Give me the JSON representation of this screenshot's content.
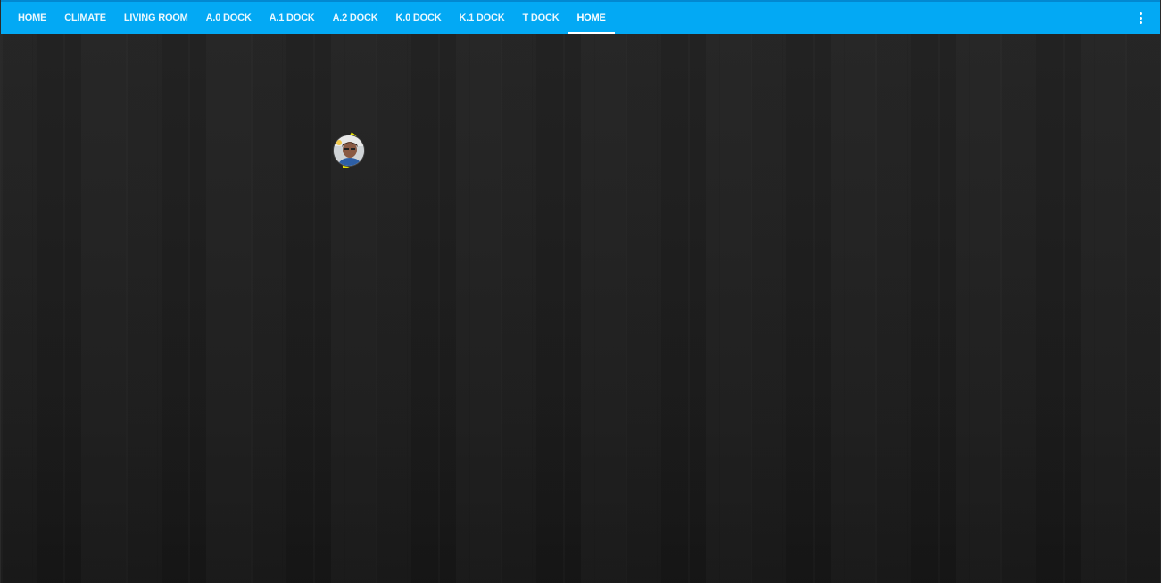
{
  "nav": {
    "tabs": [
      {
        "label": "HOME"
      },
      {
        "label": "CLIMATE"
      },
      {
        "label": "LIVING ROOM"
      },
      {
        "label": "A.0 DOCK"
      },
      {
        "label": "A.1 DOCK"
      },
      {
        "label": "A.2 DOCK"
      },
      {
        "label": "K.0 DOCK"
      },
      {
        "label": "K.1 DOCK"
      },
      {
        "label": "T DOCK"
      },
      {
        "label": "HOME"
      }
    ],
    "active_tab_index": 9,
    "menu_icon": "more-vertical-icon"
  },
  "theme": {
    "header_color": "#03a9f4",
    "accent_ring_color": "#e5e000",
    "background_color": "#1b1b1b"
  },
  "person": {
    "avatar_icon": "person-avatar-icon",
    "ring_color": "#e5e000"
  }
}
